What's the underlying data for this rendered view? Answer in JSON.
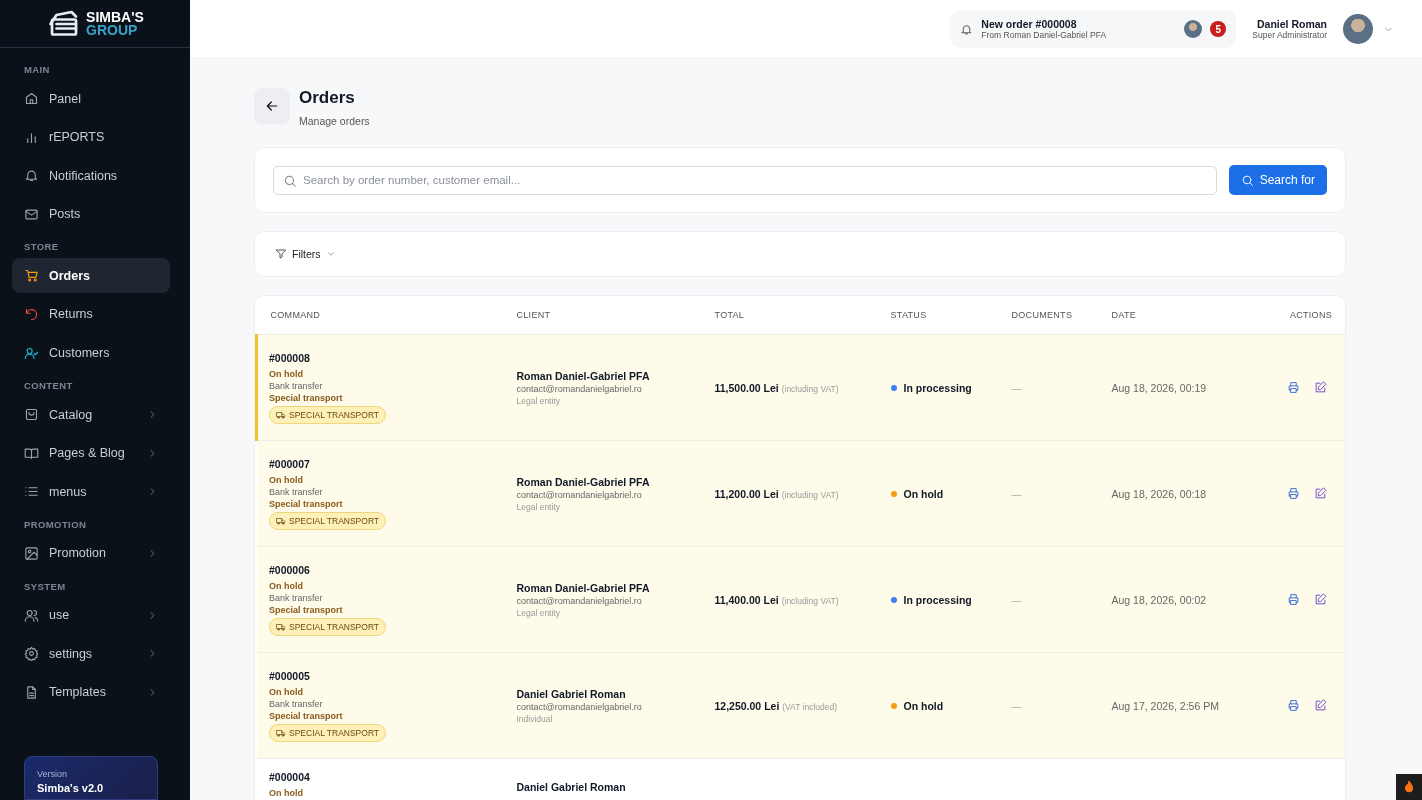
{
  "sidebar": {
    "logo": {
      "line1": "SIMBA'S",
      "line2": "GROUP"
    },
    "sections": [
      {
        "title": "MAIN",
        "items": [
          {
            "label": "Panel",
            "kind": "link",
            "selected": false
          },
          {
            "label": "rEPORTS",
            "kind": "link",
            "selected": false
          },
          {
            "label": "Notifications",
            "kind": "link",
            "selected": false
          },
          {
            "label": "Posts",
            "kind": "link",
            "selected": false
          }
        ]
      },
      {
        "title": "STORE",
        "items": [
          {
            "label": "Orders",
            "kind": "link",
            "selected": true
          },
          {
            "label": "Returns",
            "kind": "link",
            "selected": false
          },
          {
            "label": "Customers",
            "kind": "link",
            "selected": false
          }
        ]
      },
      {
        "title": "CONTENT",
        "items": [
          {
            "label": "Catalog",
            "kind": "submenu",
            "selected": false
          },
          {
            "label": "Pages & Blog",
            "kind": "submenu",
            "selected": false
          },
          {
            "label": "menus",
            "kind": "submenu",
            "selected": false
          }
        ]
      },
      {
        "title": "PROMOTION",
        "items": [
          {
            "label": "Promotion",
            "kind": "submenu",
            "selected": false
          }
        ]
      },
      {
        "title": "SYSTEM",
        "items": [
          {
            "label": "use",
            "kind": "submenu",
            "selected": false
          },
          {
            "label": "settings",
            "kind": "submenu",
            "selected": false
          },
          {
            "label": "Templates",
            "kind": "submenu",
            "selected": false
          }
        ]
      }
    ],
    "version": {
      "label": "Version",
      "name": "Simba's v2.0"
    }
  },
  "topbar": {
    "notification": {
      "title": "New order #000008",
      "subtitle": "From Roman Daniel-Gabriel PFA"
    },
    "badge": "5",
    "user": {
      "name": "Daniel Roman",
      "role": "Super Administrator"
    }
  },
  "page": {
    "title": "Orders",
    "subtitle": "Manage orders"
  },
  "search": {
    "placeholder": "Search by order number, customer email...",
    "button": "Search for"
  },
  "filters": {
    "label": "Filters"
  },
  "table": {
    "columns": [
      "COMMAND",
      "CLIENT",
      "TOTAL",
      "STATUS",
      "DOCUMENTS",
      "DATE",
      "ACTIONS"
    ],
    "rows": [
      {
        "selected": true,
        "number": "#000008",
        "order_status": "On hold",
        "payment": "Bank transfer",
        "shipping": "Special transport",
        "tag": "SPECIAL TRANSPORT",
        "client": "Roman Daniel-Gabriel PFA",
        "email": "contact@romandanielgabriel.ro",
        "client_type": "Legal entity",
        "amount": "11,500.00 Lei",
        "vat_note": "(including VAT)",
        "status": "In processing",
        "color": "#3b82f6",
        "documents": "—",
        "date": "Aug 18, 2026, 00:19"
      },
      {
        "selected": false,
        "number": "#000007",
        "order_status": "On hold",
        "payment": "Bank transfer",
        "shipping": "Special transport",
        "tag": "SPECIAL TRANSPORT",
        "client": "Roman Daniel-Gabriel PFA",
        "email": "contact@romandanielgabriel.ro",
        "client_type": "Legal entity",
        "amount": "11,200.00 Lei",
        "vat_note": "(including VAT)",
        "status": "On hold",
        "color": "#f59e0b",
        "documents": "—",
        "date": "Aug 18, 2026, 00:18"
      },
      {
        "selected": false,
        "number": "#000006",
        "order_status": "On hold",
        "payment": "Bank transfer",
        "shipping": "Special transport",
        "tag": "SPECIAL TRANSPORT",
        "client": "Roman Daniel-Gabriel PFA",
        "email": "contact@romandanielgabriel.ro",
        "client_type": "Legal entity",
        "amount": "11,400.00 Lei",
        "vat_note": "(including VAT)",
        "status": "In processing",
        "color": "#3b82f6",
        "documents": "—",
        "date": "Aug 18, 2026, 00:02"
      },
      {
        "selected": false,
        "number": "#000005",
        "order_status": "On hold",
        "payment": "Bank transfer",
        "shipping": "Special transport",
        "tag": "SPECIAL TRANSPORT",
        "client": "Daniel Gabriel Roman",
        "email": "contact@romandanielgabriel.ro",
        "client_type": "Individual",
        "amount": "12,250.00 Lei",
        "vat_note": "(VAT included)",
        "status": "On hold",
        "color": "#f59e0b",
        "documents": "—",
        "date": "Aug 17, 2026, 2:56 PM"
      },
      {
        "selected": false,
        "number": "#000004",
        "order_status": "On hold",
        "client": "Daniel Gabriel Roman"
      }
    ]
  }
}
